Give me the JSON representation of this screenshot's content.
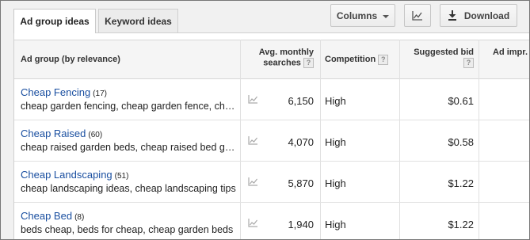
{
  "tabs": [
    {
      "label": "Ad group ideas",
      "active": true
    },
    {
      "label": "Keyword ideas",
      "active": false
    }
  ],
  "toolbar": {
    "columns_label": "Columns",
    "chart_icon": "line-chart-icon",
    "download_label": "Download",
    "download_icon": "download-icon"
  },
  "table": {
    "headers": {
      "ad_group": "Ad group (by relevance)",
      "avg_searches_line1": "Avg. monthly",
      "avg_searches_line2": "searches",
      "competition": "Competition",
      "suggested_bid": "Suggested bid",
      "ad_impr": "Ad impr.",
      "help": "?"
    },
    "rows": [
      {
        "name": "Cheap Fencing",
        "count": "(17)",
        "keywords": "cheap garden fencing, cheap garden fence, cheap garden fencing ideas",
        "searches": "6,150",
        "competition": "High",
        "bid": "$0.61"
      },
      {
        "name": "Cheap Raised",
        "count": "(60)",
        "keywords": "cheap raised garden beds, cheap raised bed gardens",
        "searches": "4,070",
        "competition": "High",
        "bid": "$0.58"
      },
      {
        "name": "Cheap Landscaping",
        "count": "(51)",
        "keywords": "cheap landscaping ideas, cheap landscaping tips",
        "searches": "5,870",
        "competition": "High",
        "bid": "$1.22"
      },
      {
        "name": "Cheap Bed",
        "count": "(8)",
        "keywords": "beds cheap, beds for cheap, cheap garden beds",
        "searches": "1,940",
        "competition": "High",
        "bid": "$1.22"
      }
    ]
  },
  "colors": {
    "link": "#1a4fa0",
    "text": "#222222",
    "header_bg": "#f5f5f5"
  }
}
